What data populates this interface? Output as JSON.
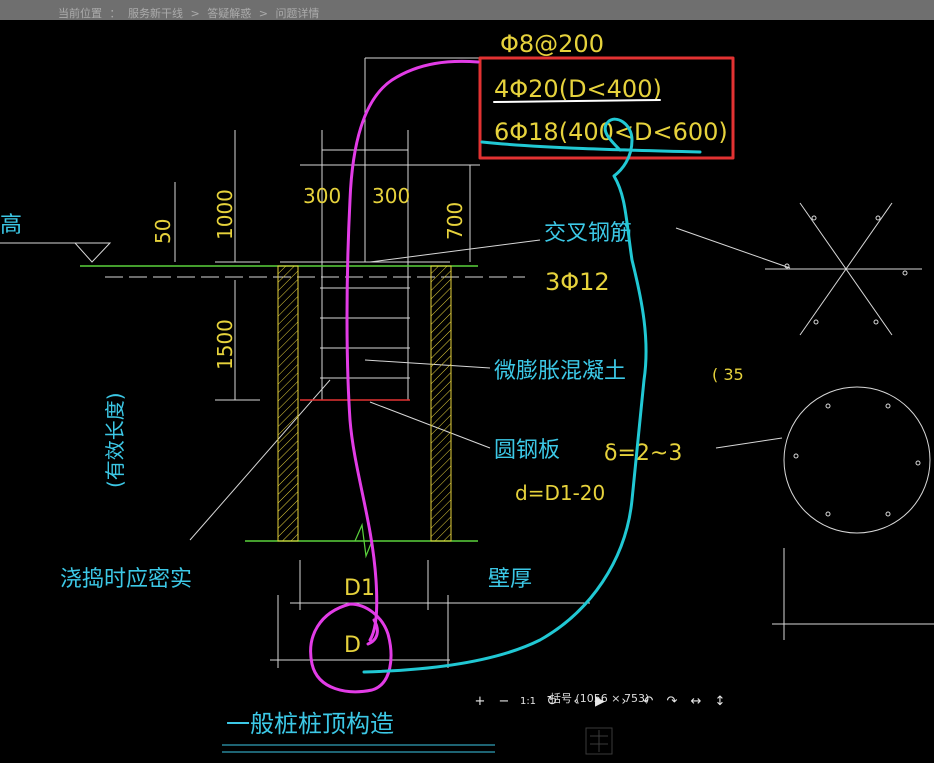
{
  "breadcrumb": {
    "items": [
      "当前位置",
      "：",
      "服务新干线",
      ">",
      "答疑解惑",
      ">",
      "问题详情"
    ]
  },
  "drawing": {
    "stirrup_spec": "Φ8@200",
    "rebar_option_1": "4Φ20(D<400)",
    "rebar_option_2": "6Φ18(400<D<600)",
    "dim_300_left": "300",
    "dim_300_right": "300",
    "dim_1000": "1000",
    "dim_50": "50",
    "dim_700": "700",
    "dim_1500": "1500",
    "label_cross_bars": "交叉钢筋",
    "label_3phi12": "3Φ12",
    "label_micro_expansion_concrete": "微膨胀混凝土",
    "label_round_steel_plate": "圆钢板",
    "label_delta": "δ=2~3",
    "label_d_formula": "d=D1-20",
    "label_effective_length": "(有效长度)",
    "label_elevation_partial": "高",
    "label_compact_when_pouring": "浇捣时应密实",
    "label_d1": "D1",
    "label_wall_thickness": "壁厚",
    "label_d": "D",
    "label_bracket_35": "( 35",
    "drawing_title": "一般桩桩顶构造"
  },
  "viewer": {
    "caption": "括号 (1056 × 753)",
    "toolbar": {
      "zoom_in": "+",
      "zoom_out": "−",
      "actual_size": "1:1",
      "rotate": "↻",
      "prev": "‹",
      "play": "▶",
      "next": "›",
      "undo": "↶",
      "redo": "↷",
      "flip_h": "↔",
      "flip_v": "↕"
    }
  },
  "colors": {
    "annotation_red": "#e23232",
    "annotation_magenta": "#e23ce6",
    "annotation_cyan": "#21c8d4",
    "cad_yellow": "#e6d23c",
    "cad_cyan": "#3cc8e6",
    "cad_white": "#d8d8d8",
    "cad_green": "#5ad23c"
  }
}
